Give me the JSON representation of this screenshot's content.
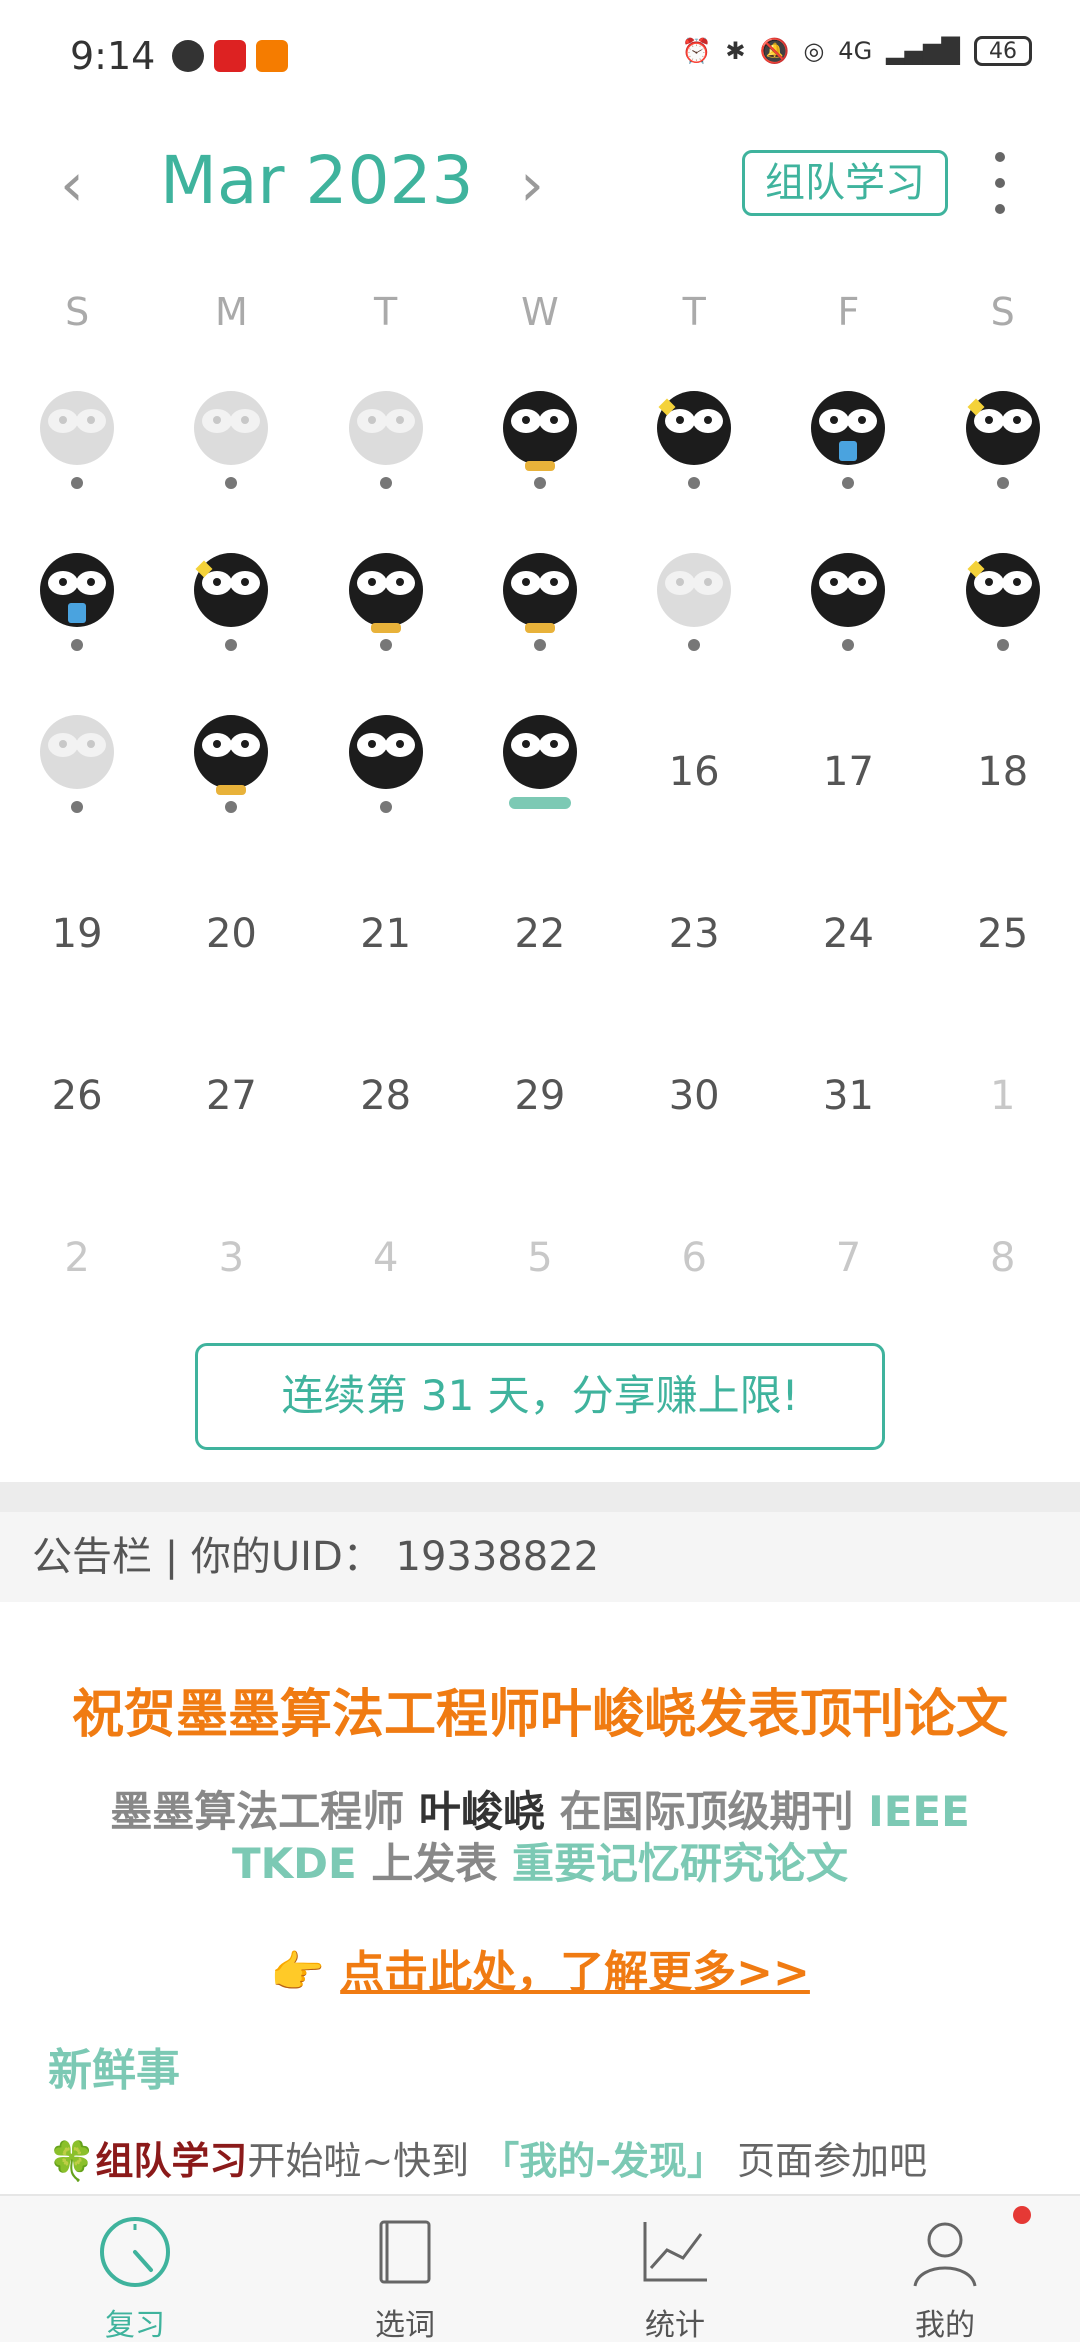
{
  "status_bar": {
    "time": "9:14",
    "battery": "46",
    "signal": "4G"
  },
  "header": {
    "month": "Mar 2023",
    "team_button": "组队学习",
    "prev": "‹",
    "next": "›"
  },
  "calendar": {
    "weekdays": [
      "S",
      "M",
      "T",
      "W",
      "T",
      "F",
      "S"
    ],
    "rows": [
      [
        {
          "icon": "owl-faded"
        },
        {
          "icon": "owl-faded"
        },
        {
          "icon": "owl-faded"
        },
        {
          "icon": "owl-feet"
        },
        {
          "icon": "owl-star"
        },
        {
          "icon": "owl-cup"
        },
        {
          "icon": "owl-star"
        }
      ],
      [
        {
          "icon": "owl-cup"
        },
        {
          "icon": "owl-star"
        },
        {
          "icon": "owl-feet"
        },
        {
          "icon": "owl-feet"
        },
        {
          "icon": "owl-faded"
        },
        {
          "icon": "owl"
        },
        {
          "icon": "owl-star"
        }
      ],
      [
        {
          "icon": "owl-faded"
        },
        {
          "icon": "owl-feet"
        },
        {
          "icon": "owl"
        },
        {
          "icon": "owl-today"
        },
        {
          "day": "16"
        },
        {
          "day": "17"
        },
        {
          "day": "18"
        }
      ],
      [
        {
          "day": "19"
        },
        {
          "day": "20"
        },
        {
          "day": "21"
        },
        {
          "day": "22"
        },
        {
          "day": "23"
        },
        {
          "day": "24"
        },
        {
          "day": "25"
        }
      ],
      [
        {
          "day": "26"
        },
        {
          "day": "27"
        },
        {
          "day": "28"
        },
        {
          "day": "29"
        },
        {
          "day": "30"
        },
        {
          "day": "31"
        },
        {
          "day": "1",
          "other": true
        }
      ],
      [
        {
          "day": "2",
          "other": true
        },
        {
          "day": "3",
          "other": true
        },
        {
          "day": "4",
          "other": true
        },
        {
          "day": "5",
          "other": true
        },
        {
          "day": "6",
          "other": true
        },
        {
          "day": "7",
          "other": true
        },
        {
          "day": "8",
          "other": true
        }
      ]
    ]
  },
  "streak_button": "连续第 31 天，分享赚上限!",
  "bulletin": {
    "label": "公告栏 | 你的UID： 19338822"
  },
  "announcement": {
    "title": "祝贺墨墨算法工程师叶峻峣发表顶刊论文",
    "body_a": "墨墨算法工程师 ",
    "body_name": "叶峻峣",
    "body_b": " 在国际顶级期刊 ",
    "body_journal": "IEEE TKDE",
    "body_c": " 上发表 ",
    "body_paper": "重要记忆研究论文",
    "link_emoji": "👉",
    "link_text": "点击此处，了解更多>>"
  },
  "news": {
    "heading": "新鲜事",
    "clover": "🍀",
    "team": "组队学习",
    "text_a": "开始啦~快到 ",
    "target": "「我的-发现」",
    "text_b": " 页面参加吧"
  },
  "tabs": [
    {
      "label": "复习",
      "active": true
    },
    {
      "label": "选词"
    },
    {
      "label": "统计"
    },
    {
      "label": "我的",
      "badge": true
    }
  ]
}
